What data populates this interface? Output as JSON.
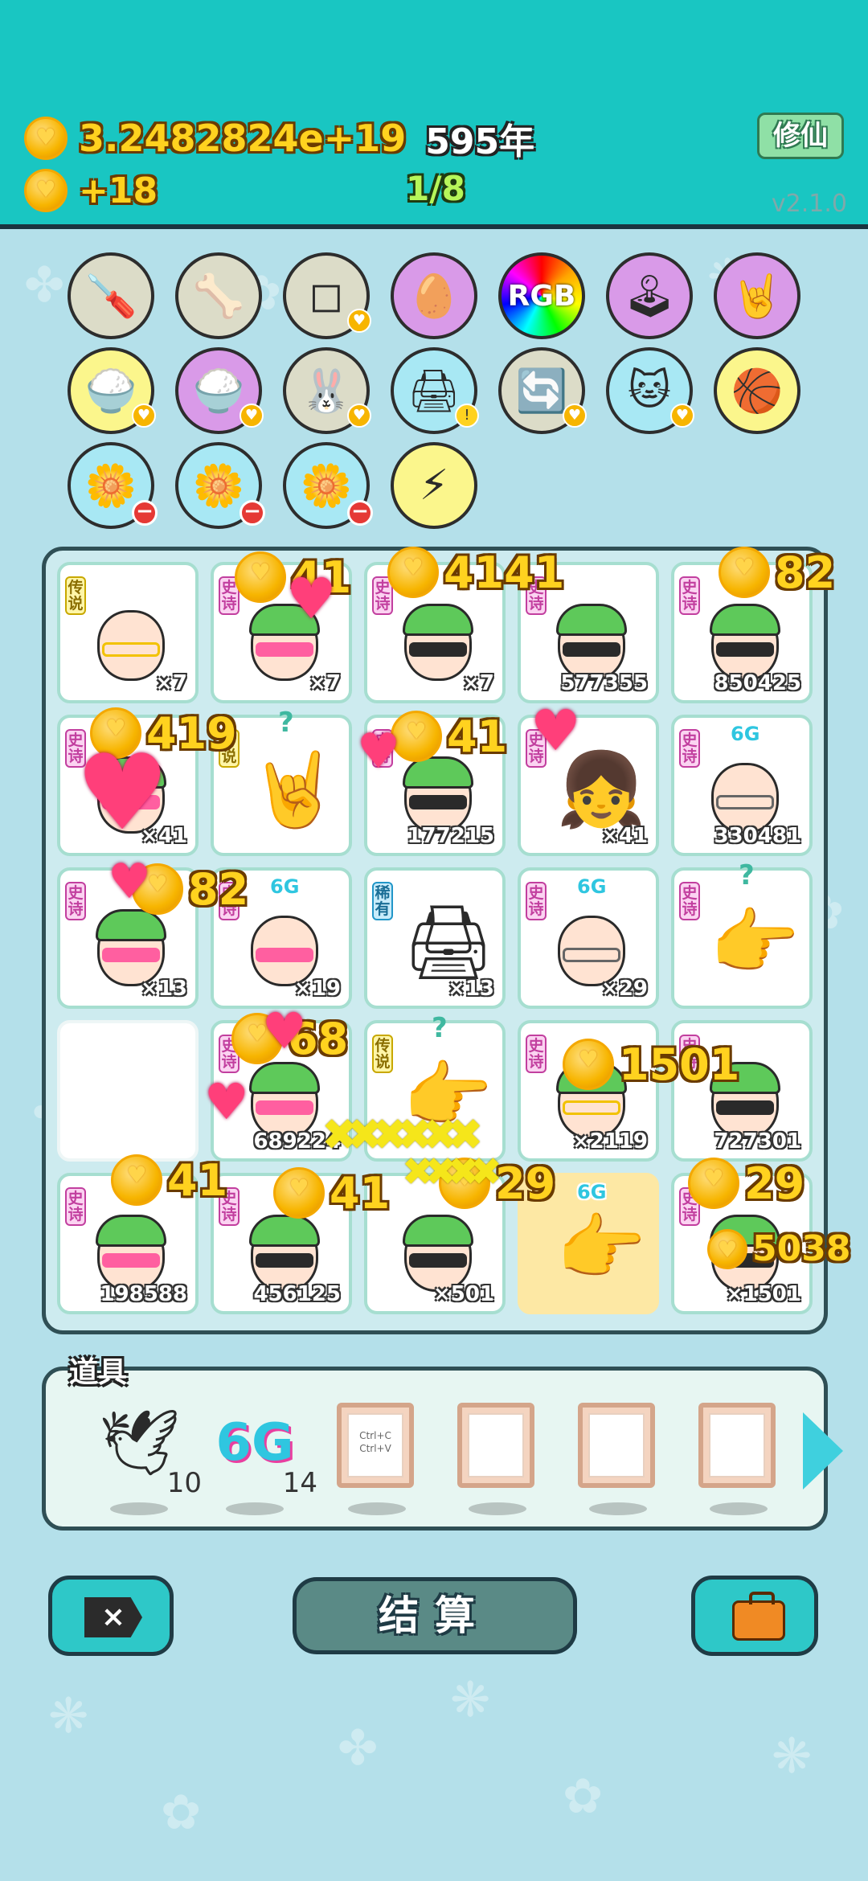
{
  "header": {
    "currency_total": "3.2482824e+19",
    "years": "595年",
    "income": "+18",
    "progress": "1/8",
    "xiuxian_button": "修仙",
    "version": "v2.1.0"
  },
  "items": [
    {
      "name": "screwdriver-icon",
      "color": "gray",
      "glyph": "🪛"
    },
    {
      "name": "pet-bowl-icon",
      "color": "gray",
      "glyph": "🦴"
    },
    {
      "name": "sugar-cubes-icon",
      "color": "gray",
      "glyph": "⬜"
    },
    {
      "name": "egg-icon",
      "color": "purple",
      "glyph": "🥚"
    },
    {
      "name": "rgb-icon",
      "color": "rainbow",
      "label": "RGB"
    },
    {
      "name": "arcade-icon",
      "color": "purple",
      "glyph": "🕹"
    },
    {
      "name": "rock-hand-icon",
      "color": "purple",
      "glyph": "🤘"
    },
    {
      "name": "rice-bowl-icon",
      "color": "yellow",
      "glyph": "🍚"
    },
    {
      "name": "rice-bowl-icon",
      "color": "purple",
      "glyph": "🍚"
    },
    {
      "name": "rabbit-icon",
      "color": "gray",
      "glyph": "🐰"
    },
    {
      "name": "printer-icon",
      "color": "blue",
      "glyph": "🖨"
    },
    {
      "name": "refresh-icon",
      "color": "gray",
      "glyph": "🔄"
    },
    {
      "name": "cat-icon",
      "color": "blue",
      "glyph": "🐱"
    },
    {
      "name": "basketballs-icon",
      "color": "yellow",
      "glyph": "🏀"
    },
    {
      "name": "flower-pot-icon",
      "color": "blue",
      "glyph": "🌼"
    },
    {
      "name": "flower-pot-icon",
      "color": "blue",
      "glyph": "🌼"
    },
    {
      "name": "flower-pot-icon",
      "color": "blue",
      "glyph": "🌼"
    },
    {
      "name": "lightning-icon",
      "color": "yellow",
      "glyph": "⚡"
    }
  ],
  "tags": {
    "epic": "史诗",
    "legend": "传说",
    "rare": "稀有",
    "net": "6G"
  },
  "board": {
    "cells": [
      {
        "id": "r1c1",
        "tag": "legend",
        "kind": "face",
        "glasses": "gold",
        "hat": false,
        "count": "×7"
      },
      {
        "id": "r1c2",
        "tag": "epic",
        "kind": "face",
        "glasses": "pink",
        "hat": true,
        "count": "×7"
      },
      {
        "id": "r1c3",
        "tag": "epic",
        "kind": "face",
        "glasses": "dark",
        "hat": true,
        "count": "×7"
      },
      {
        "id": "r1c4",
        "tag": "epic",
        "kind": "face",
        "glasses": "dark",
        "hat": true,
        "count": "577355"
      },
      {
        "id": "r1c5",
        "tag": "epic",
        "kind": "face",
        "glasses": "dark",
        "hat": true,
        "count": "850425"
      },
      {
        "id": "r2c1",
        "tag": "epic",
        "kind": "face",
        "glasses": "pink",
        "hat": true,
        "count": "×41"
      },
      {
        "id": "r2c2",
        "tag": "legend",
        "kind": "hand",
        "glyph": "🤘",
        "count": ""
      },
      {
        "id": "r2c3",
        "tag": "epic",
        "kind": "face",
        "glasses": "dark",
        "hat": true,
        "count": "177215"
      },
      {
        "id": "r2c4",
        "tag": "epic",
        "kind": "girl",
        "count": "×41"
      },
      {
        "id": "r2c5",
        "tag": "epic",
        "kind": "face",
        "glasses": "clear",
        "hat": false,
        "count": "330481"
      },
      {
        "id": "r3c1",
        "tag": "epic",
        "kind": "face",
        "glasses": "pink",
        "hat": true,
        "count": "×13"
      },
      {
        "id": "r3c2",
        "tag": "epic",
        "kind": "face",
        "glasses": "pink",
        "hat": false,
        "count": "×19"
      },
      {
        "id": "r3c3",
        "tag": "rare",
        "kind": "printer",
        "count": "×13"
      },
      {
        "id": "r3c4",
        "tag": "epic",
        "kind": "face",
        "glasses": "clear",
        "hat": false,
        "count": "×29"
      },
      {
        "id": "r3c5",
        "tag": "epic",
        "kind": "hand",
        "glyph": "👉",
        "count": ""
      },
      {
        "id": "r4c1",
        "tag": "",
        "kind": "empty",
        "count": ""
      },
      {
        "id": "r4c2",
        "tag": "epic",
        "kind": "face",
        "glasses": "pink",
        "hat": true,
        "count": "689224"
      },
      {
        "id": "r4c3",
        "tag": "legend",
        "kind": "hand",
        "glyph": "👉",
        "count": ""
      },
      {
        "id": "r4c4",
        "tag": "epic",
        "kind": "face",
        "glasses": "gold",
        "hat": true,
        "count": "×2119"
      },
      {
        "id": "r4c5",
        "tag": "epic",
        "kind": "face",
        "glasses": "dark",
        "hat": true,
        "count": "727301"
      },
      {
        "id": "r5c1",
        "tag": "epic",
        "kind": "face",
        "glasses": "pink",
        "hat": true,
        "count": "198588"
      },
      {
        "id": "r5c2",
        "tag": "epic",
        "kind": "face",
        "glasses": "dark",
        "hat": true,
        "count": "456125"
      },
      {
        "id": "r5c3",
        "tag": "",
        "kind": "face",
        "glasses": "dark",
        "hat": true,
        "count": "×501"
      },
      {
        "id": "r5c4",
        "tag": "",
        "kind": "hand",
        "glyph": "👉",
        "count": "",
        "highlight": true
      },
      {
        "id": "r5c5",
        "tag": "epic",
        "kind": "face",
        "glasses": "dark",
        "hat": true,
        "count": "×1501"
      }
    ],
    "floating_gains": [
      "41",
      "4141",
      "82",
      "419",
      "41",
      "82",
      "68",
      "1501",
      "41",
      "41",
      "29",
      "29",
      "5038"
    ]
  },
  "props": {
    "label": "道具",
    "items": [
      {
        "name": "pigeon-prop",
        "glyph": "🕊",
        "count": "10"
      },
      {
        "name": "6g-prop",
        "label": "6G",
        "count": "14"
      },
      {
        "name": "ctrl-c-v-prop",
        "text1": "Ctrl+C",
        "text2": "Ctrl+V"
      },
      {
        "name": "empty-frame-prop"
      },
      {
        "name": "empty-frame-prop"
      },
      {
        "name": "empty-frame-prop"
      }
    ]
  },
  "footer": {
    "settle_label": "结算",
    "close_icon": "×"
  },
  "colors": {
    "topbar": "#19c6c2",
    "background": "#b4e0ea",
    "gold": "#ffd21f",
    "accent_green": "#b6f65a"
  }
}
